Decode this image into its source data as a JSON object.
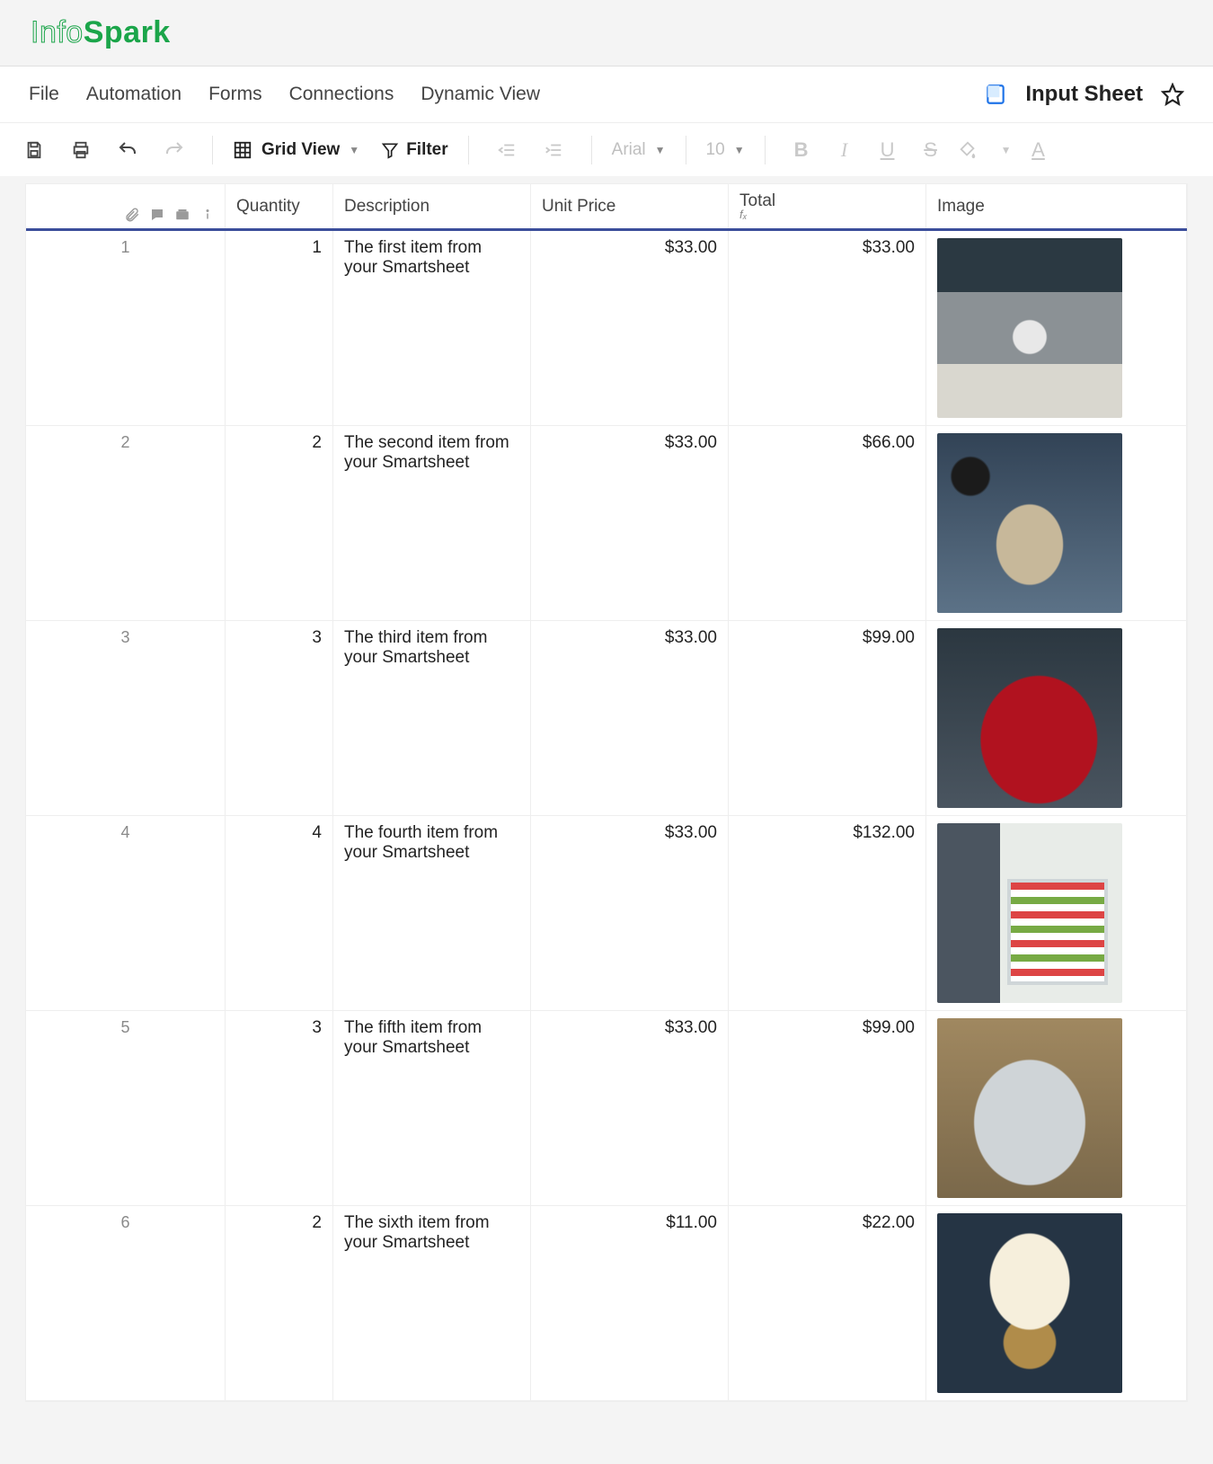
{
  "brand": {
    "part1": "Info",
    "part2": "Spark"
  },
  "menu": {
    "file": "File",
    "automation": "Automation",
    "forms": "Forms",
    "connections": "Connections",
    "dynamic_view": "Dynamic View"
  },
  "sheet": {
    "title": "Input Sheet"
  },
  "toolbar": {
    "view_label": "Grid View",
    "filter_label": "Filter",
    "font_name": "Arial",
    "font_size": "10"
  },
  "columns": {
    "quantity": "Quantity",
    "description": "Description",
    "unit_price": "Unit Price",
    "total": "Total",
    "total_fx": "fₓ",
    "image": "Image"
  },
  "rows": [
    {
      "num": "1",
      "qty": "1",
      "desc": "The first item from your Smartsheet",
      "unit": "$33.00",
      "total": "$33.00",
      "img": "img1"
    },
    {
      "num": "2",
      "qty": "2",
      "desc": "The second item from your Smartsheet",
      "unit": "$33.00",
      "total": "$66.00",
      "img": "img2"
    },
    {
      "num": "3",
      "qty": "3",
      "desc": "The third item from your Smartsheet",
      "unit": "$33.00",
      "total": "$99.00",
      "img": "img3"
    },
    {
      "num": "4",
      "qty": "4",
      "desc": "The fourth item from your Smartsheet",
      "unit": "$33.00",
      "total": "$132.00",
      "img": "img4"
    },
    {
      "num": "5",
      "qty": "3",
      "desc": "The fifth item from your Smartsheet",
      "unit": "$33.00",
      "total": "$99.00",
      "img": "img5"
    },
    {
      "num": "6",
      "qty": "2",
      "desc": "The sixth item from your Smartsheet",
      "unit": "$11.00",
      "total": "$22.00",
      "img": "img6"
    }
  ]
}
